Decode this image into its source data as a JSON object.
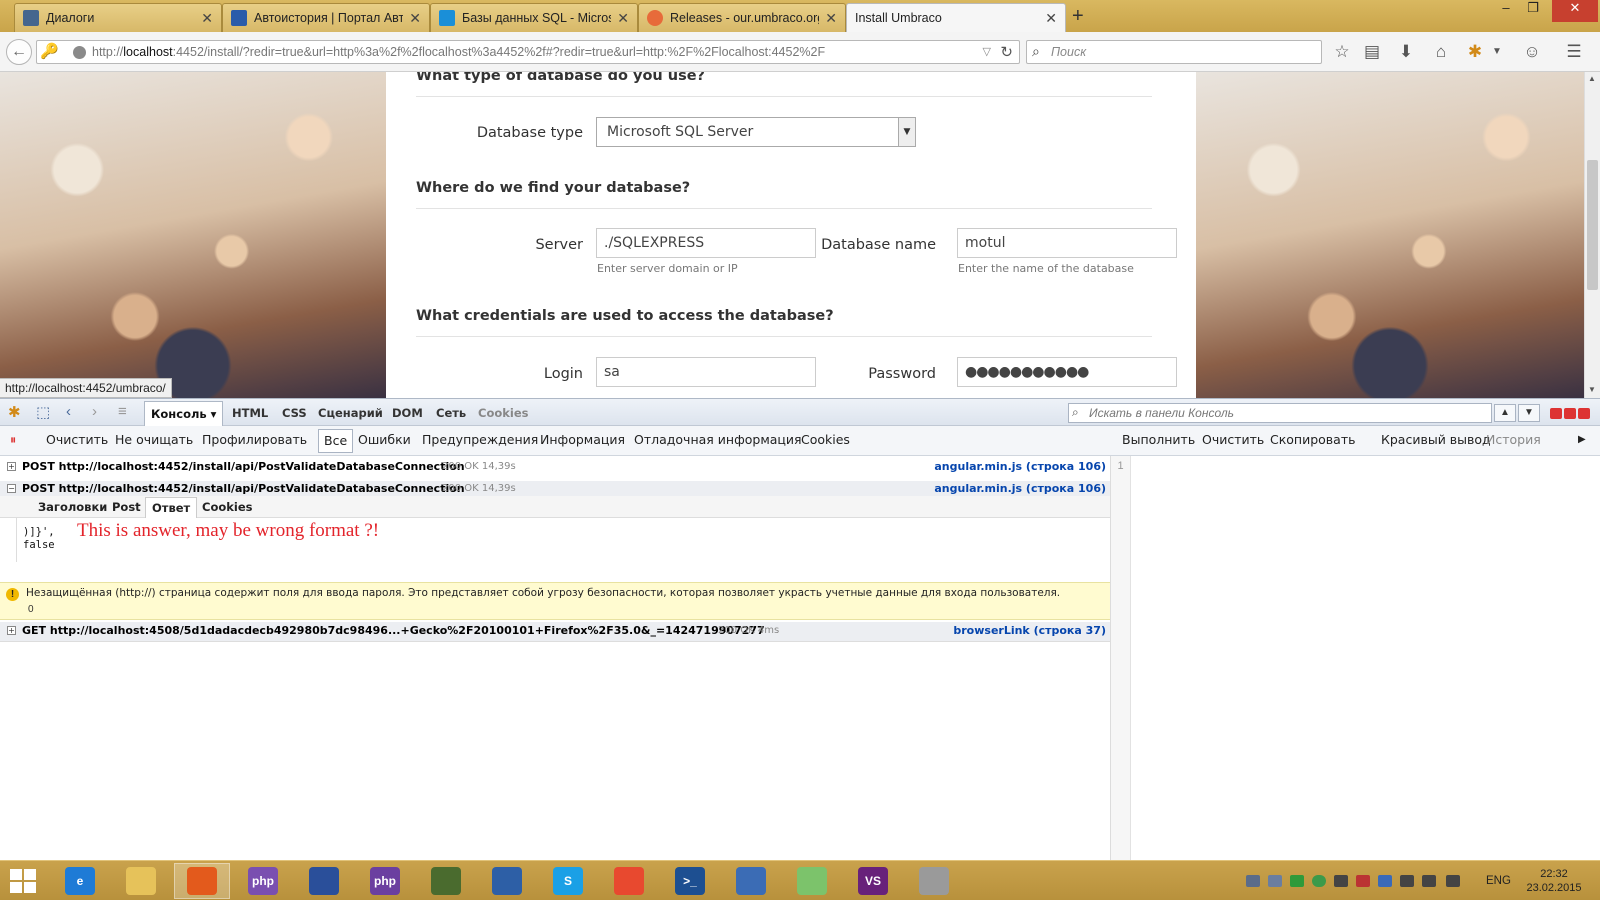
{
  "browser": {
    "tabs": [
      {
        "title": "Диалоги",
        "icon": "vk-icon",
        "color": "#45668e"
      },
      {
        "title": "Автоистория | Портал Авт...",
        "icon": "car-icon",
        "color": "#2a5caa"
      },
      {
        "title": "Базы данных SQL - Micros...",
        "icon": "windows-icon",
        "color": "#1a8fd8"
      },
      {
        "title": "Releases - our.umbraco.org",
        "icon": "umbraco-icon",
        "color": "#e76b3a"
      },
      {
        "title": "Install Umbraco",
        "icon": "blank-icon",
        "color": "#ffffff"
      }
    ],
    "url_prefix": "http://",
    "url_host": "localhost",
    "url_rest": ":4452/install/?redir=true&url=http%3a%2f%2flocalhost%3a4452%2f#?redir=true&url=http:%2F%2Flocalhost:4452%2F",
    "search_placeholder": "Поиск",
    "status_link": "http://localhost:4452/umbraco/"
  },
  "installer": {
    "section_db_type": "What type of database do you use?",
    "db_type_label": "Database type",
    "db_type_value": "Microsoft SQL Server",
    "section_location": "Where do we find your database?",
    "server_label": "Server",
    "server_value": "./SQLEXPRESS",
    "server_hint": "Enter server domain or IP",
    "dbname_label": "Database name",
    "dbname_value": "motul",
    "dbname_hint": "Enter the name of the database",
    "section_credentials": "What credentials are used to access the database?",
    "login_label": "Login",
    "login_value": "sa",
    "password_label": "Password",
    "password_value": "●●●●●●●●●●●"
  },
  "firebug": {
    "panels": {
      "console": "Консоль",
      "html": "HTML",
      "css": "CSS",
      "script": "Сценарий",
      "dom": "DOM",
      "net": "Сеть",
      "cookies": "Cookies"
    },
    "search_placeholder": "Искать в панели Консоль",
    "toolbar": {
      "clear": "Очистить",
      "persist": "Не очищать",
      "profile": "Профилировать",
      "all": "Все",
      "errors": "Ошибки",
      "warnings": "Предупреждения",
      "info": "Информация",
      "debug": "Отладочная информация",
      "cookies": "Cookies",
      "run": "Выполнить",
      "clear2": "Очистить",
      "copy": "Скопировать",
      "pretty": "Красивый вывод",
      "history": "История"
    },
    "log": [
      {
        "request": "POST http://localhost:4452/install/api/PostValidateDatabaseConnection",
        "status": "200 OK 14,39s",
        "source": "angular.min.js (строка 106)",
        "expanded": "+"
      },
      {
        "request": "POST http://localhost:4452/install/api/PostValidateDatabaseConnection",
        "status": "200 OK 14,39s",
        "source": "angular.min.js (строка 106)",
        "expanded": "−"
      }
    ],
    "subtabs": {
      "headers": "Заголовки",
      "post": "Post",
      "response": "Ответ",
      "cookies": "Cookies"
    },
    "response_line1": ")]}',",
    "response_line2": "false",
    "annotation": "This is answer, may be wrong format ?!",
    "warning_text": "Незащищённая (http://) страница содержит поля для ввода пароля. Это представляет собой угрозу безопасности, которая позволяет украсть учетные данные для входа пользователя.",
    "warning_count": "0",
    "get_row": {
      "request": "GET http://localhost:4508/5d1dadacdecb492980b7dc98496...+Gecko%2F20100101+Firefox%2F35.0&_=1424719907277",
      "status": "200 OK 4ms",
      "source": "browserLink (строка 37)",
      "expanded": "+"
    },
    "editor_line": "1"
  },
  "taskbar": {
    "apps": [
      {
        "name": "internet-explorer-icon",
        "label": "e",
        "color": "#1e7bd6"
      },
      {
        "name": "file-explorer-icon",
        "label": "",
        "color": "#e6c25a"
      },
      {
        "name": "firefox-icon",
        "label": "",
        "color": "#e35a1c"
      },
      {
        "name": "phpstorm-icon",
        "label": "php",
        "color": "#7a4fb0"
      },
      {
        "name": "save-disk-icon",
        "label": "",
        "color": "#2a4f9a"
      },
      {
        "name": "phpstorm2-icon",
        "label": "php",
        "color": "#6b3fa0"
      },
      {
        "name": "security-tool-icon",
        "label": "",
        "color": "#4a6b2e"
      },
      {
        "name": "remote-desktop-icon",
        "label": "",
        "color": "#2d5fa6"
      },
      {
        "name": "skype-icon",
        "label": "S",
        "color": "#1aa0e6"
      },
      {
        "name": "git-icon",
        "label": "",
        "color": "#e8492f"
      },
      {
        "name": "powershell-icon",
        "label": ">_",
        "color": "#1d4f91"
      },
      {
        "name": "network-admin-icon",
        "label": "",
        "color": "#3b6cb5"
      },
      {
        "name": "notepad-icon",
        "label": "",
        "color": "#7cc36b"
      },
      {
        "name": "visual-studio-icon",
        "label": "VS",
        "color": "#68217a"
      },
      {
        "name": "snipping-tool-icon",
        "label": "",
        "color": "#9a9a9a"
      }
    ],
    "language": "ENG",
    "time": "22:32",
    "date": "23.02.2015"
  }
}
